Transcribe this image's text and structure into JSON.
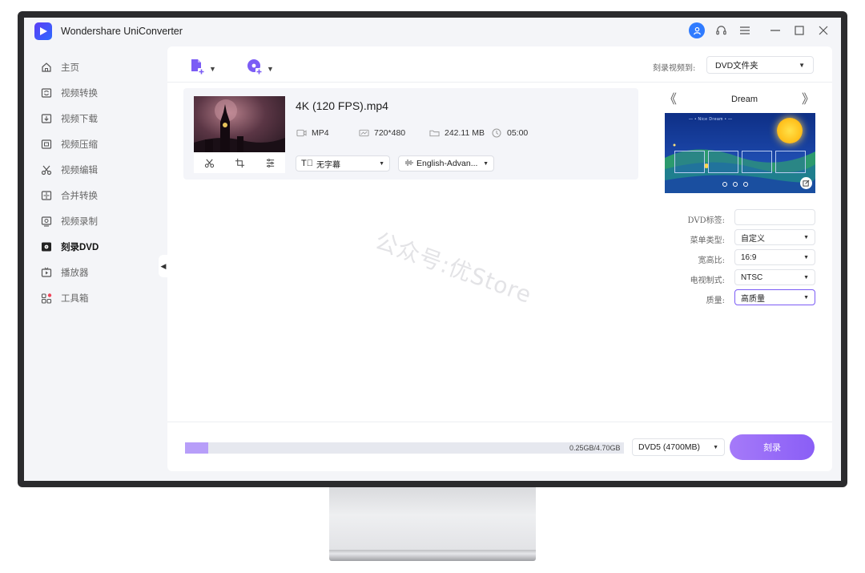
{
  "window": {
    "title": "Wondershare UniConverter",
    "controls": {
      "minimize": "—",
      "maximize": "☐",
      "close": "✕"
    }
  },
  "sidebar": {
    "items": [
      {
        "label": "主页",
        "icon": "home-icon"
      },
      {
        "label": "视频转换",
        "icon": "convert-icon"
      },
      {
        "label": "视频下载",
        "icon": "download-icon"
      },
      {
        "label": "视频压缩",
        "icon": "compress-icon"
      },
      {
        "label": "视频编辑",
        "icon": "scissors-icon"
      },
      {
        "label": "合并转换",
        "icon": "merge-icon"
      },
      {
        "label": "视频录制",
        "icon": "record-icon"
      },
      {
        "label": "刻录DVD",
        "icon": "dvd-icon",
        "active": true
      },
      {
        "label": "播放器",
        "icon": "player-icon"
      },
      {
        "label": "工具箱",
        "icon": "toolbox-icon"
      }
    ]
  },
  "toolbar": {
    "burn_to_label": "刻录视频到:",
    "burn_to_value": "DVD文件夹"
  },
  "file": {
    "name": "4K (120 FPS).mp4",
    "format": "MP4",
    "resolution": "720*480",
    "size": "242.11 MB",
    "duration": "05:00",
    "subtitle": "无字幕",
    "audio": "English-Advan..."
  },
  "template": {
    "name": "Dream",
    "preview_title": "Nice Dream"
  },
  "properties": {
    "dvd_label": {
      "label": "DVD标签:",
      "value": ""
    },
    "menu_type": {
      "label": "菜单类型:",
      "value": "自定义"
    },
    "aspect_ratio": {
      "label": "宽高比:",
      "value": "16:9"
    },
    "tv_standard": {
      "label": "电视制式:",
      "value": "NTSC"
    },
    "quality": {
      "label": "质量:",
      "value": "高质量"
    }
  },
  "bottom": {
    "capacity": "0.25GB/4.70GB",
    "capacity_fraction": 0.053,
    "disc_type": "DVD5 (4700MB)",
    "burn_label": "刻录"
  },
  "watermark": "公众号:优Store",
  "colors": {
    "accent": "#8a5ef6",
    "progress": "#b79ef9",
    "avatar": "#2f7bff"
  }
}
